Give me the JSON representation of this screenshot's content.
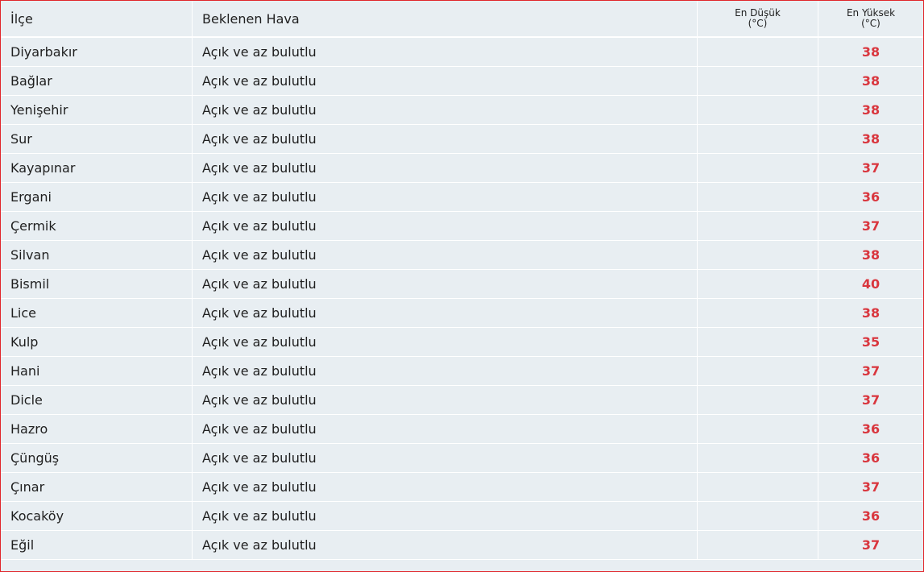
{
  "table": {
    "headers": {
      "district": "İlçe",
      "expected_weather": "Beklenen Hava",
      "min_temp_line1": "En Düşük",
      "min_temp_line2": "(°C)",
      "max_temp_line1": "En Yüksek",
      "max_temp_line2": "(°C)"
    },
    "rows": [
      {
        "district": "Diyarbakır",
        "weather": "Açık ve az bulutlu",
        "min": "",
        "max": "38"
      },
      {
        "district": "Bağlar",
        "weather": "Açık ve az bulutlu",
        "min": "",
        "max": "38"
      },
      {
        "district": "Yenişehir",
        "weather": "Açık ve az bulutlu",
        "min": "",
        "max": "38"
      },
      {
        "district": "Sur",
        "weather": "Açık ve az bulutlu",
        "min": "",
        "max": "38"
      },
      {
        "district": "Kayapınar",
        "weather": "Açık ve az bulutlu",
        "min": "",
        "max": "37"
      },
      {
        "district": "Ergani",
        "weather": "Açık ve az bulutlu",
        "min": "",
        "max": "36"
      },
      {
        "district": "Çermik",
        "weather": "Açık ve az bulutlu",
        "min": "",
        "max": "37"
      },
      {
        "district": "Silvan",
        "weather": "Açık ve az bulutlu",
        "min": "",
        "max": "38"
      },
      {
        "district": "Bismil",
        "weather": "Açık ve az bulutlu",
        "min": "",
        "max": "40"
      },
      {
        "district": "Lice",
        "weather": "Açık ve az bulutlu",
        "min": "",
        "max": "38"
      },
      {
        "district": "Kulp",
        "weather": "Açık ve az bulutlu",
        "min": "",
        "max": "35"
      },
      {
        "district": "Hani",
        "weather": "Açık ve az bulutlu",
        "min": "",
        "max": "37"
      },
      {
        "district": "Dicle",
        "weather": "Açık ve az bulutlu",
        "min": "",
        "max": "37"
      },
      {
        "district": "Hazro",
        "weather": "Açık ve az bulutlu",
        "min": "",
        "max": "36"
      },
      {
        "district": "Çüngüş",
        "weather": "Açık ve az bulutlu",
        "min": "",
        "max": "36"
      },
      {
        "district": "Çınar",
        "weather": "Açık ve az bulutlu",
        "min": "",
        "max": "37"
      },
      {
        "district": "Kocaköy",
        "weather": "Açık ve az bulutlu",
        "min": "",
        "max": "36"
      },
      {
        "district": "Eğil",
        "weather": "Açık ve az bulutlu",
        "min": "",
        "max": "37"
      }
    ]
  },
  "colors": {
    "frame_border": "#e0262b",
    "cell_background": "#e8eef2",
    "max_temp_text": "#d9363e"
  }
}
